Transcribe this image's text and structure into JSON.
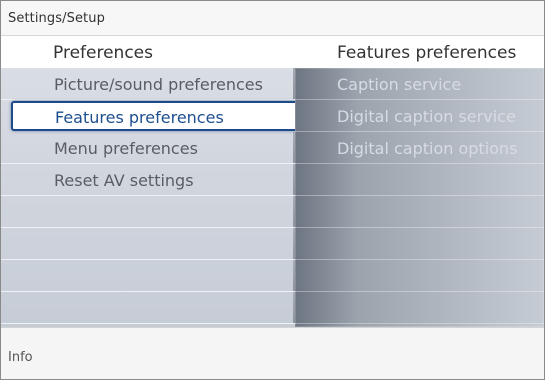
{
  "topbar": {
    "breadcrumb": "Settings/Setup"
  },
  "header": {
    "left_title": "Preferences",
    "right_title": "Features preferences"
  },
  "left_menu": {
    "items": [
      {
        "label": "Picture/sound preferences"
      },
      {
        "label": "Features preferences"
      },
      {
        "label": "Menu preferences"
      },
      {
        "label": "Reset AV settings"
      }
    ],
    "selected_index": 1
  },
  "right_menu": {
    "items": [
      {
        "label": "Caption service"
      },
      {
        "label": "Digital caption service"
      },
      {
        "label": "Digital caption options"
      }
    ]
  },
  "footer": {
    "info_label": "Info"
  },
  "colors": {
    "selection_border": "#1f4a8a",
    "selection_text": "#1d4f8f",
    "left_panel": "#d1d6de",
    "right_panel_start": "#6c7581",
    "right_panel_end": "#c6ccd4"
  }
}
